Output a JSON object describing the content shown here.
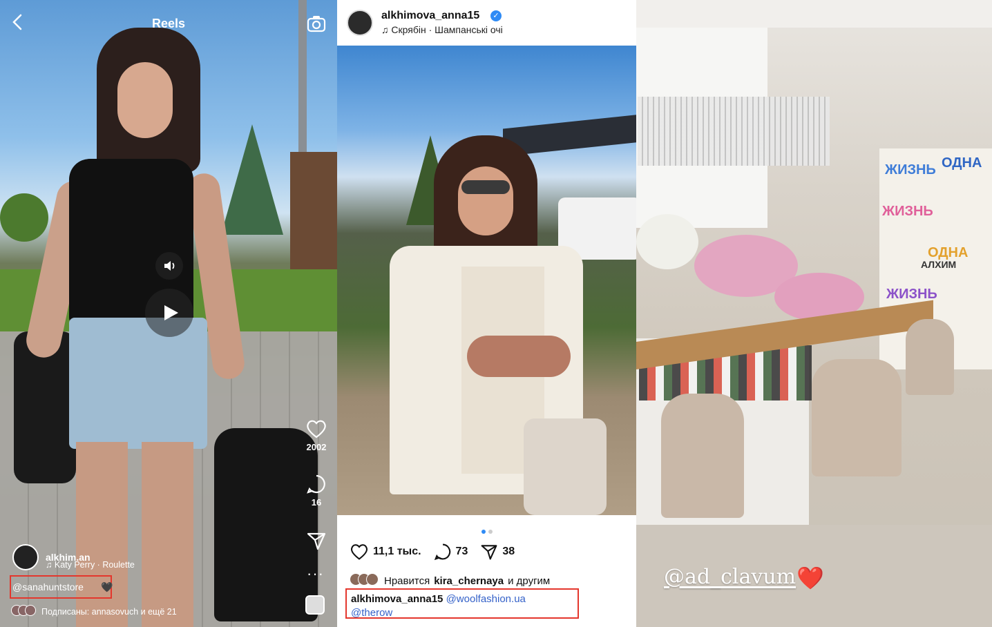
{
  "reels": {
    "header_title": "Reels",
    "likes_count": "2002",
    "comments_count": "16",
    "username": "alkhim.an",
    "audio": "Katy Perry · Roulette",
    "mention": "@sanahuntstore",
    "followers_text": "Подписаны: annasovuch и ещё 21"
  },
  "post": {
    "username": "alkhimova_anna15",
    "audio": "Скрябін · Шампанські очі",
    "likes": "11,1 тыс.",
    "comments": "73",
    "shares": "38",
    "liked_by_prefix": "Нравится",
    "liked_by_user": "kira_chernaya",
    "liked_by_suffix": "и другим",
    "caption_user": "alkhimova_anna15",
    "caption_tag1": "@woolfashion.ua",
    "caption_tag2": "@therow",
    "carousel_pages": 2,
    "carousel_active": 1
  },
  "story": {
    "mention": "@ad_clavum",
    "heart": "❤️",
    "wall_art_words": [
      "ЖИЗНЬ",
      "ОДНА",
      "ЖИЗНЬ",
      "ОДНА",
      "ЖИЗНЬ",
      "АЛХИМ"
    ]
  },
  "colors": {
    "highlight_box": "#e4362c",
    "link": "#3562c9",
    "verified": "#2f8bf5"
  }
}
